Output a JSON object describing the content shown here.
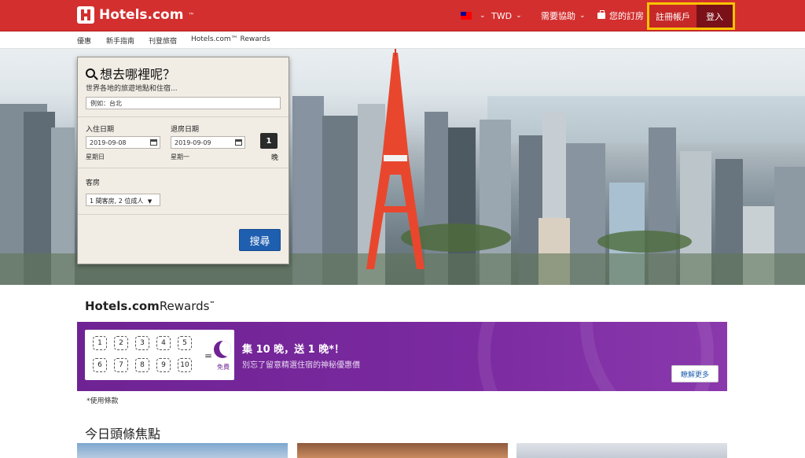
{
  "header": {
    "brand": "Hotels.com",
    "brand_tm": "™",
    "currency": "TWD",
    "help": "需要協助",
    "bookings": "您的訂房",
    "register": "註冊帳戶",
    "login": "登入"
  },
  "subnav": {
    "items": [
      "優惠",
      "新手指南",
      "刊登旅宿",
      "Hotels.com™ Rewards"
    ]
  },
  "search": {
    "title": "想去哪裡呢？",
    "subtitle": "世界各地的旅遊地點和住宿...",
    "destination_placeholder": "例如：台北",
    "checkin_label": "入住日期",
    "checkout_label": "退房日期",
    "checkin_value": "2019-09-08",
    "checkout_value": "2019-09-09",
    "checkin_weekday": "星期日",
    "checkout_weekday": "星期一",
    "nights": "1",
    "nights_label": "晚",
    "rooms_label": "客房",
    "rooms_value": "1 間客房, 2 位成人",
    "submit": "搜尋"
  },
  "rewards": {
    "logo_bold": "Hotels.com",
    "logo_light": "Rewards",
    "logo_tm": "™",
    "stamps": [
      "1",
      "2",
      "3",
      "4",
      "5",
      "6",
      "7",
      "8",
      "9",
      "10"
    ],
    "equals": "=",
    "free": "免費",
    "title": "集 10 晚，送 1 晚*！",
    "subtitle": "別忘了留意精選住宿的神秘優惠價",
    "more": "瞭解更多",
    "terms": "*使用條款"
  },
  "today": {
    "title": "今日頭條焦點"
  },
  "colors": {
    "brand_red": "#d32f2f",
    "highlight": "#f9c400",
    "rewards_purple": "#6f2393",
    "search_blue": "#1f5fb0"
  }
}
